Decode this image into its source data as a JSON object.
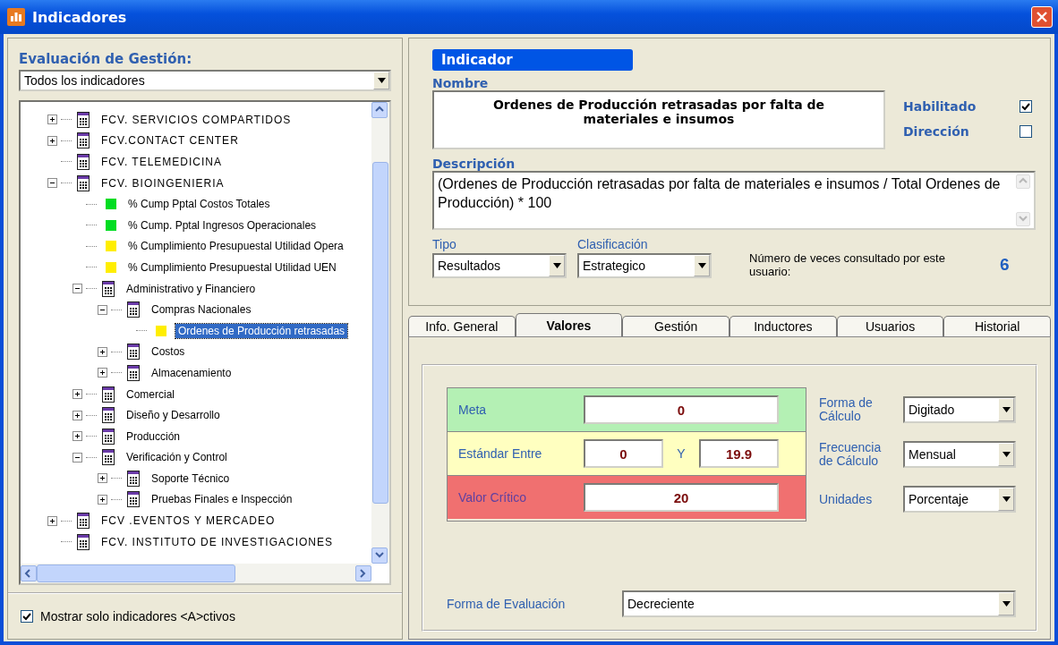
{
  "window": {
    "title": "Indicadores"
  },
  "sidebar": {
    "heading": "Evaluación de Gestión:",
    "filter": {
      "value": "Todos los indicadores"
    },
    "tree": [
      {
        "kind": "folder",
        "label": "FCV. SERVICIOS COMPARTIDOS",
        "expanded": false,
        "selected": false
      },
      {
        "kind": "folder",
        "label": "FCV.CONTACT CENTER",
        "expanded": false,
        "selected": false
      },
      {
        "kind": "folder",
        "label": "FCV. TELEMEDICINA",
        "selected": false
      },
      {
        "kind": "folder",
        "label": "FCV. BIOINGENIERIA",
        "expanded": true,
        "selected": false,
        "children": [
          {
            "kind": "indicator",
            "label": "% Cump Pptal Costos Totales",
            "color": "#00dd22",
            "selected": false
          },
          {
            "kind": "indicator",
            "label": "% Cump. Pptal Ingresos Operacionales",
            "color": "#00dd22",
            "selected": false
          },
          {
            "kind": "indicator",
            "label": "% Cumplimiento Presupuestal Utilidad Opera",
            "color": "#ffee00",
            "selected": false
          },
          {
            "kind": "indicator",
            "label": "% Cumplimiento Presupuestal Utilidad UEN",
            "color": "#ffee00",
            "selected": false
          },
          {
            "kind": "folder",
            "label": "Administrativo y Financiero",
            "expanded": true,
            "selected": false,
            "children": [
              {
                "kind": "folder",
                "label": "Compras Nacionales",
                "expanded": true,
                "selected": false,
                "children": [
                  {
                    "kind": "indicator",
                    "label": "Ordenes de Producción retrasadas",
                    "color": "#ffee00",
                    "selected": true
                  }
                ]
              },
              {
                "kind": "folder",
                "label": "Costos",
                "expanded": false,
                "selected": false
              },
              {
                "kind": "folder",
                "label": "Almacenamiento",
                "expanded": false,
                "selected": false
              }
            ]
          },
          {
            "kind": "folder",
            "label": "Comercial",
            "expanded": false,
            "selected": false
          },
          {
            "kind": "folder",
            "label": "Diseño y Desarrollo",
            "expanded": false,
            "selected": false
          },
          {
            "kind": "folder",
            "label": "Producción",
            "expanded": false,
            "selected": false
          },
          {
            "kind": "folder",
            "label": "Verificación y Control",
            "expanded": true,
            "selected": false,
            "children": [
              {
                "kind": "folder",
                "label": "Soporte Técnico",
                "expanded": false,
                "selected": false
              },
              {
                "kind": "folder",
                "label": "Pruebas Finales e Inspección",
                "expanded": false,
                "selected": false
              }
            ]
          }
        ]
      },
      {
        "kind": "folder",
        "label": "FCV .EVENTOS Y MERCADEO",
        "expanded": false,
        "selected": false
      },
      {
        "kind": "folder",
        "label": "FCV. INSTITUTO DE INVESTIGACIONES",
        "selected": false
      }
    ],
    "show_active": {
      "label": "Mostrar solo indicadores <A>ctivos",
      "checked": true
    }
  },
  "indicator": {
    "section_label": "Indicador",
    "name_label": "Nombre",
    "name": "Ordenes de Producción retrasadas por falta de materiales e insumos",
    "flags": [
      {
        "label": "Habilitado",
        "checked": true
      },
      {
        "label": "Dirección",
        "checked": false
      }
    ],
    "description_label": "Descripción",
    "description": "(Ordenes de Producción retrasadas por falta de materiales e insumos / Total Ordenes de Producción) * 100",
    "selects": [
      {
        "label": "Tipo",
        "value": "Resultados"
      },
      {
        "label": "Clasificación",
        "value": "Estrategico"
      }
    ],
    "consult_label": "Número de veces consultado por este usuario:",
    "consult_count": "6"
  },
  "tabs": [
    {
      "label": "Info. General",
      "selected": false
    },
    {
      "label": "Valores",
      "selected": true
    },
    {
      "label": "Gestión",
      "selected": false
    },
    {
      "label": "Inductores",
      "selected": false
    },
    {
      "label": "Usuarios",
      "selected": false
    },
    {
      "label": "Historial",
      "selected": false
    }
  ],
  "valores": {
    "thresholds": [
      {
        "kind": "meta",
        "label": "Meta",
        "values": [
          "0"
        ]
      },
      {
        "kind": "standard",
        "label": "Estándar Entre",
        "values": [
          "0",
          "19.9"
        ],
        "separator": "Y"
      },
      {
        "kind": "critical",
        "label": "Valor Crítico",
        "values": [
          "20"
        ]
      }
    ],
    "settings": [
      {
        "label": "Forma de Cálculo",
        "value": "Digitado"
      },
      {
        "label": "Frecuencia de Cálculo",
        "value": "Mensual"
      },
      {
        "label": "Unidades",
        "value": "Porcentaje"
      }
    ],
    "evaluation": {
      "label": "Forma de Evaluación",
      "value": "Decreciente"
    }
  }
}
